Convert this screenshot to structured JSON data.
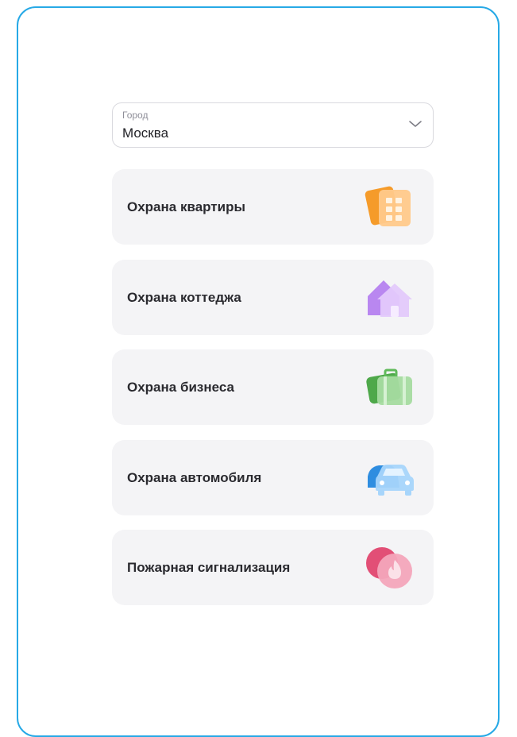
{
  "city": {
    "label": "Город",
    "value": "Москва",
    "icon": "chevron-down-icon"
  },
  "services": [
    {
      "label": "Охрана квартиры",
      "icon": "apartment-icon",
      "color": "#f5a13a"
    },
    {
      "label": "Охрана коттеджа",
      "icon": "cottage-icon",
      "color": "#c79af5"
    },
    {
      "label": "Охрана бизнеса",
      "icon": "briefcase-icon",
      "color": "#5fba5a"
    },
    {
      "label": "Охрана автомобиля",
      "icon": "car-icon",
      "color": "#4aa6ea"
    },
    {
      "label": "Пожарная сигнализация",
      "icon": "fire-icon",
      "color": "#e8557b"
    }
  ],
  "colors": {
    "border_accent": "#27a9e6",
    "card_background": "#f4f4f6"
  }
}
